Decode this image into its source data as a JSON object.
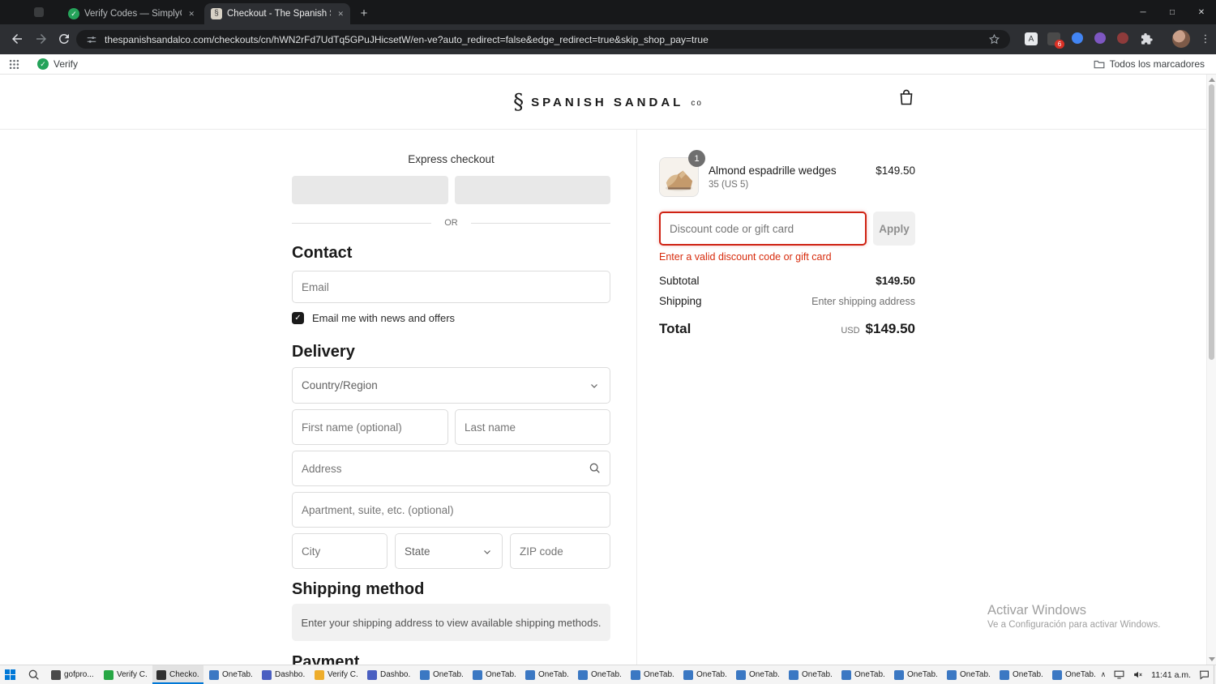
{
  "browser": {
    "tabs": [
      {
        "title": "Verify Codes — SimplyCodes"
      },
      {
        "title": "Checkout - The Spanish Sandal"
      }
    ],
    "url": "thespanishsandalco.com/checkouts/cn/hWN2rFd7UdTq5GPuJHicsetW/en-ve?auto_redirect=false&edge_redirect=true&skip_shop_pay=true",
    "extension_badge": "6",
    "bookmarks": {
      "verify": "Verify",
      "all_bookmarks": "Todos los marcadores"
    }
  },
  "page": {
    "logo": {
      "mark": "§",
      "text": "SPANISH SANDAL",
      "suffix": "co"
    },
    "express": {
      "label": "Express checkout",
      "or": "OR"
    },
    "contact": {
      "heading": "Contact",
      "email_placeholder": "Email",
      "newsletter": "Email me with news and offers",
      "newsletter_checked": true
    },
    "delivery": {
      "heading": "Delivery",
      "country": "Country/Region",
      "first_name": "First name (optional)",
      "last_name": "Last name",
      "address": "Address",
      "apartment": "Apartment, suite, etc. (optional)",
      "city": "City",
      "state": "State",
      "zip": "ZIP code"
    },
    "shipping_method": {
      "heading": "Shipping method",
      "message": "Enter your shipping address to view available shipping methods."
    },
    "payment": {
      "heading": "Payment"
    }
  },
  "summary": {
    "item": {
      "qty": "1",
      "name": "Almond espadrille wedges",
      "variant": "35 (US 5)",
      "price": "$149.50"
    },
    "discount": {
      "placeholder": "Discount code or gift card",
      "apply": "Apply",
      "error": "Enter a valid discount code or gift card"
    },
    "rows": {
      "subtotal_label": "Subtotal",
      "subtotal_value": "$149.50",
      "shipping_label": "Shipping",
      "shipping_value": "Enter shipping address",
      "total_label": "Total",
      "currency": "USD",
      "total_value": "$149.50"
    }
  },
  "watermark": {
    "line1": "Activar Windows",
    "line2": "Ve a Configuración para activar Windows."
  },
  "taskbar": {
    "time": "11:41 a.m.",
    "items": [
      {
        "label": "gofpro...",
        "color": "#4a4a4a"
      },
      {
        "label": "Verify C...",
        "color": "#28a745"
      },
      {
        "label": "Checko...",
        "color": "#303030",
        "active": true
      },
      {
        "label": "OneTab...",
        "color": "#3b78c3"
      },
      {
        "label": "Dashbo...",
        "color": "#4a5fc1"
      },
      {
        "label": "Verify C...",
        "color": "#eead2b"
      },
      {
        "label": "Dashbo...",
        "color": "#4a5fc1"
      },
      {
        "label": "OneTab...",
        "color": "#3b78c3"
      },
      {
        "label": "OneTab...",
        "color": "#3b78c3"
      },
      {
        "label": "OneTab...",
        "color": "#3b78c3"
      },
      {
        "label": "OneTab...",
        "color": "#3b78c3"
      },
      {
        "label": "OneTab...",
        "color": "#3b78c3"
      },
      {
        "label": "OneTab...",
        "color": "#3b78c3"
      },
      {
        "label": "OneTab...",
        "color": "#3b78c3"
      },
      {
        "label": "OneTab...",
        "color": "#3b78c3"
      },
      {
        "label": "OneTab...",
        "color": "#3b78c3"
      },
      {
        "label": "OneTab...",
        "color": "#3b78c3"
      },
      {
        "label": "OneTab...",
        "color": "#3b78c3"
      },
      {
        "label": "OneTab...",
        "color": "#3b78c3"
      },
      {
        "label": "OneTab...",
        "color": "#3b78c3"
      }
    ]
  },
  "icons": {
    "close": "✕",
    "check": "✓",
    "plus": "+",
    "kebab": "⋮",
    "minimize": "─",
    "maximize": "□",
    "tray_chevron": "∧",
    "logo_mark": "§"
  },
  "colors": {
    "error_red": "#d72c0d",
    "taskbar_accent": "#0078d7",
    "checkbox": "#1a1a1a",
    "badge_red": "#d93025"
  }
}
